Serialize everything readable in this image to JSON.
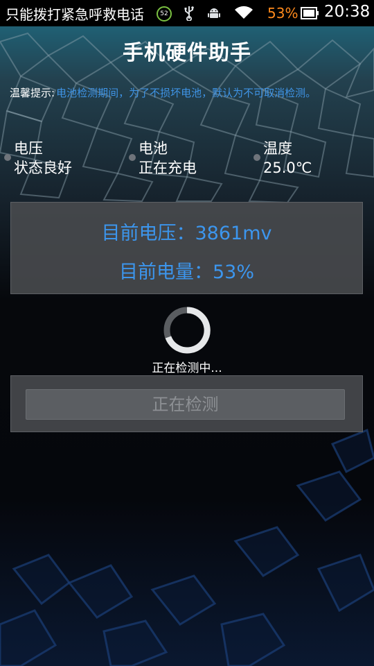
{
  "status_bar": {
    "carrier": "只能拨打紧急呼救电话",
    "badge": "52",
    "battery_percent": "53%",
    "time": "20:38"
  },
  "header": {
    "title": "手机硬件助手"
  },
  "tip": {
    "label": "温馨提示:",
    "text": "电池检测期间，为了不损坏电池，默认为不可取消检测。"
  },
  "status": [
    {
      "label": "电压",
      "value": "状态良好"
    },
    {
      "label": "电池",
      "value": "正在充电"
    },
    {
      "label": "温度",
      "value": "25.0℃"
    }
  ],
  "info": {
    "voltage": "目前电压：3861mv",
    "level": "目前电量：53%"
  },
  "progress": {
    "text": "正在检测中..."
  },
  "button": {
    "label": "正在检测"
  },
  "colors": {
    "accent": "#3c96ee",
    "tip": "#3f94e6",
    "battery": "#ff8a1c"
  },
  "icons": [
    "usb-icon",
    "android-icon",
    "wifi-icon",
    "battery-icon",
    "spinner-icon"
  ]
}
